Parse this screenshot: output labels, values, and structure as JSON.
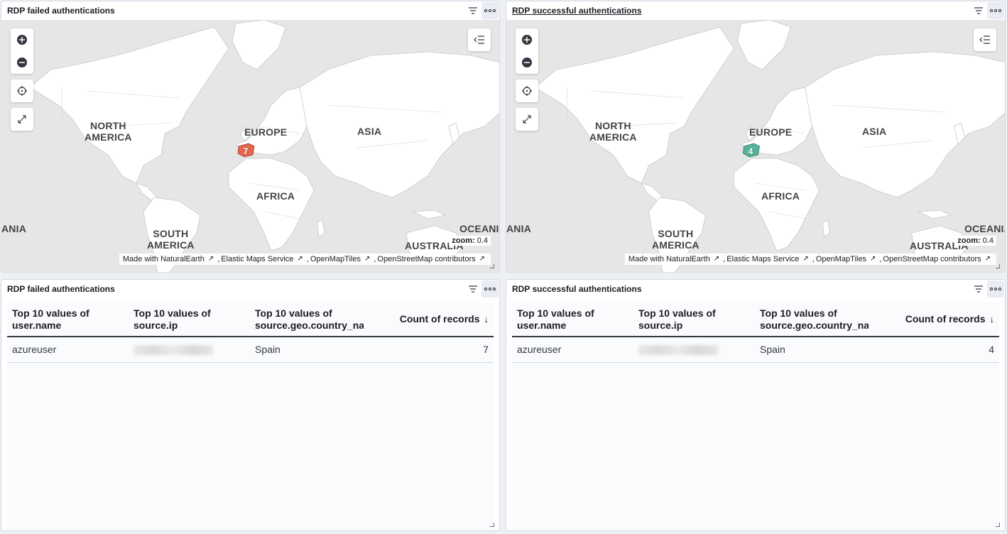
{
  "panels": {
    "map_failed": {
      "title": "RDP failed authentications",
      "cluster_count": "7",
      "cluster_color": "#e7664c",
      "zoom_label": "zoom:",
      "zoom_value": "0.4"
    },
    "map_success": {
      "title": "RDP successful authentications",
      "cluster_count": "4",
      "cluster_color": "#54b399",
      "zoom_label": "zoom:",
      "zoom_value": "0.4"
    },
    "table_failed": {
      "title": "RDP failed authentications",
      "columns": [
        "Top 10 values of user.name",
        "Top 10 values of source.ip",
        "Top 10 values of source.geo.country_na",
        "Count of records"
      ],
      "rows": [
        {
          "user": "azureuser",
          "ip": "",
          "country": "Spain",
          "count": "7"
        }
      ]
    },
    "table_success": {
      "title": "RDP successful authentications",
      "columns": [
        "Top 10 values of user.name",
        "Top 10 values of source.ip",
        "Top 10 values of source.geo.country_na",
        "Count of records"
      ],
      "rows": [
        {
          "user": "azureuser",
          "ip": "",
          "country": "Spain",
          "count": "4"
        }
      ]
    }
  },
  "map_labels": {
    "north_america": "NORTH\nAMERICA",
    "europe": "EUROPE",
    "asia": "ASIA",
    "africa": "AFRICA",
    "south_america": "SOUTH\nAMERICA",
    "oceania_left": "ANIA",
    "oceania_right": "OCEANIA",
    "australia": "AUSTRALIA"
  },
  "attribution": {
    "natural_earth": "Made with NaturalEarth",
    "ems": "Elastic Maps Service",
    "openmaptiles": "OpenMapTiles",
    "osm": "OpenStreetMap contributors"
  },
  "icons": {
    "filter": "filter-icon",
    "menu": "ellipsis-icon",
    "zoom_in": "plus-circle-icon",
    "zoom_out": "minus-circle-icon",
    "locate": "crosshair-icon",
    "fullscreen": "expand-icon",
    "layers": "layers-collapse-icon",
    "external": "external-link-icon",
    "sort": "arrow-down-icon"
  }
}
